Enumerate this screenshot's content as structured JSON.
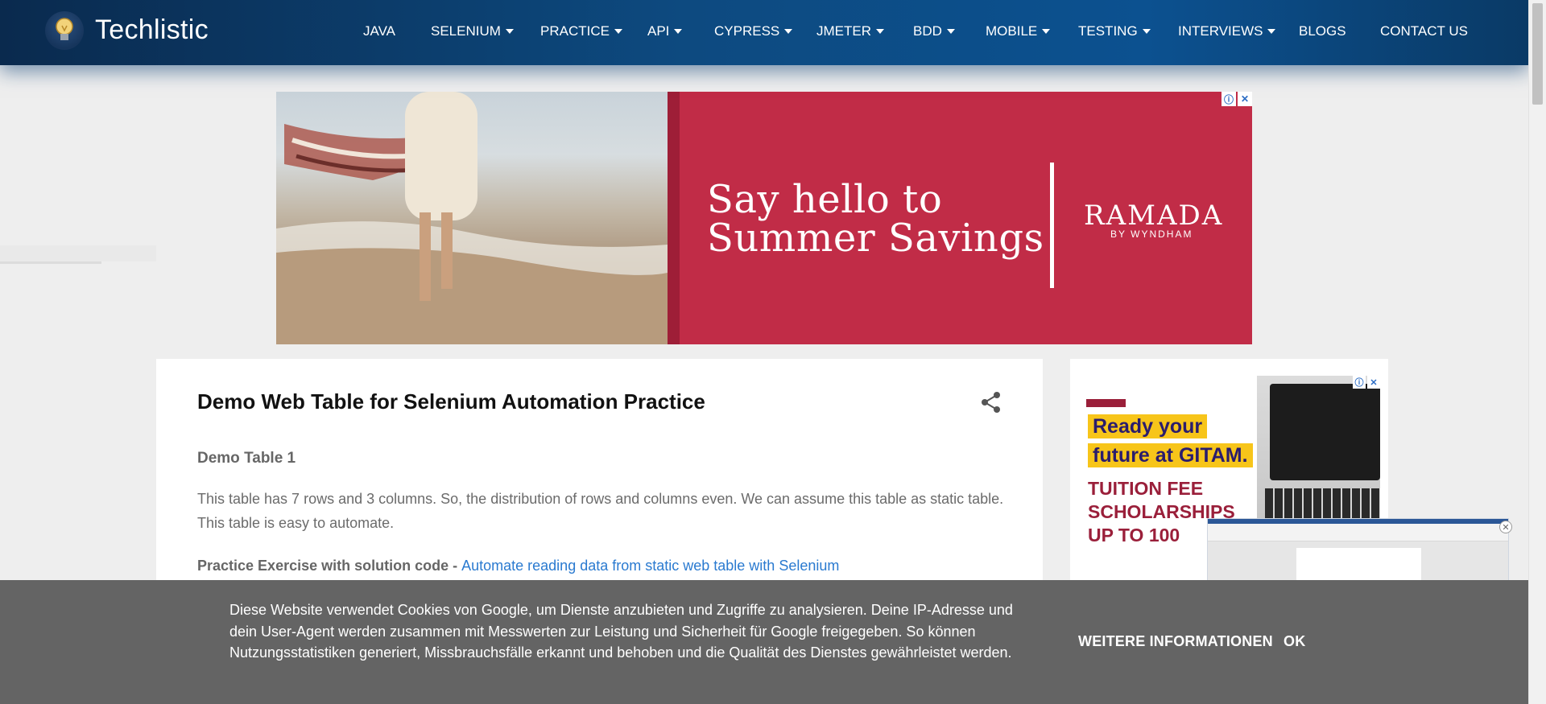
{
  "header": {
    "site_title": "Techlistic",
    "logo_icon": "lightbulb-icon",
    "nav": [
      {
        "label": "JAVA",
        "dropdown": false
      },
      {
        "label": "SELENIUM",
        "dropdown": true
      },
      {
        "label": "PRACTICE",
        "dropdown": true
      },
      {
        "label": "API",
        "dropdown": true
      },
      {
        "label": "CYPRESS",
        "dropdown": true
      },
      {
        "label": "JMETER",
        "dropdown": true
      },
      {
        "label": "BDD",
        "dropdown": true
      },
      {
        "label": "MOBILE",
        "dropdown": true
      },
      {
        "label": "TESTING",
        "dropdown": true
      },
      {
        "label": "INTERVIEWS",
        "dropdown": true
      },
      {
        "label": "BLOGS",
        "dropdown": false
      },
      {
        "label": "CONTACT US",
        "dropdown": false
      }
    ]
  },
  "ad_top": {
    "headline_line1": "Say hello to",
    "headline_line2": "Summer Savings",
    "brand": "RAMADA",
    "brand_sub": "BY WYNDHAM",
    "info_icon": "info-icon",
    "close_icon": "close-icon",
    "color": "#c12c47"
  },
  "post": {
    "title": "Demo Web Table for Selenium Automation Practice",
    "subheading": "Demo Table 1",
    "paragraph": "This table has 7 rows and 3 columns. So, the distribution of rows and columns even. We can assume this table as static table. This table is easy to automate.",
    "exercise_label": "Practice Exercise with solution code - ",
    "exercise_link": "Automate reading data from static web table with Selenium",
    "share_icon": "share-icon"
  },
  "side_ad": {
    "line1": "Ready your",
    "line2": "future at GITAM.",
    "tuition_1": "TUITION FEE",
    "tuition_2": "SCHOLARSHIPS",
    "tuition_3": "UP TO 100"
  },
  "cookie": {
    "text": "Diese Website verwendet Cookies von Google, um Dienste anzubieten und Zugriffe zu analysieren. Deine IP-Adresse und dein User-Agent werden zusammen mit Messwerten zur Leistung und Sicherheit für Google freigegeben. So können Nutzungsstatistiken generiert, Missbrauchsfälle erkannt und behoben und die Qualität des Dienstes gewährleistet werden.",
    "more_info": "WEITERE INFORMATIONEN",
    "ok": "OK"
  }
}
